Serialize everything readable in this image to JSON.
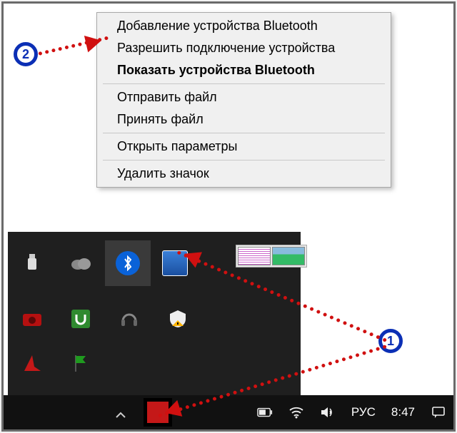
{
  "context_menu": {
    "items": [
      "Добавление устройства Bluetooth",
      "Разрешить подключение устройства",
      "Показать устройства Bluetooth",
      "Отправить файл",
      "Принять файл",
      "Открыть параметры",
      "Удалить значок"
    ]
  },
  "tray_icons_row1": [
    "usb",
    "onedrive",
    "bluetooth",
    "intel-graphics"
  ],
  "tray_icons_row2": [
    "camera",
    "utorrent",
    "headset",
    "security-warning"
  ],
  "tray_icons_row3": [
    "app-red-triangle",
    "flag-green"
  ],
  "taskbar": {
    "lang": "РУС",
    "time": "8:47"
  },
  "annotations": {
    "badge1": "1",
    "badge2": "2"
  }
}
